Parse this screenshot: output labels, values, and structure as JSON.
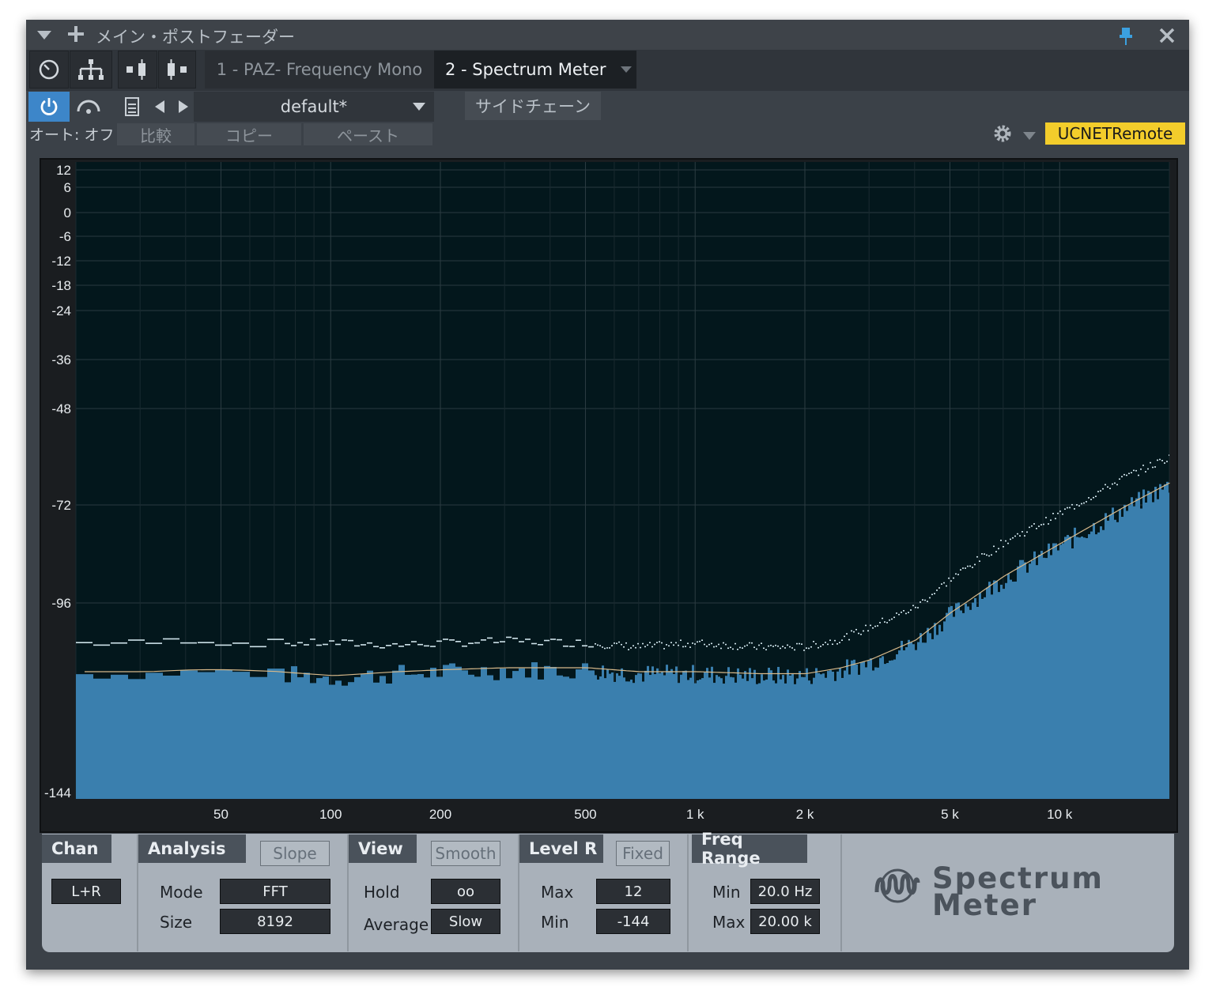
{
  "window": {
    "title": "メイン・ポストフェーダー",
    "tabs": [
      {
        "label": "1 - PAZ- Frequency Mono"
      },
      {
        "label": "2 - Spectrum Meter"
      }
    ]
  },
  "toolbar": {
    "preset": "default*",
    "sidechain": "サイドチェーン",
    "auto": "オート: オフ",
    "compare": "比較",
    "copy": "コピー",
    "paste": "ペースト",
    "remote": "UCNETRemote"
  },
  "colors": {
    "accent": "#3d86c9",
    "remote": "#f3cd2b",
    "spectrum_fill": "#3a7fae",
    "display_bg": "#03171c"
  },
  "spectrum": {
    "y_ticks": [
      "12",
      "6",
      "0",
      "-6",
      "-12",
      "-18",
      "-24",
      "-36",
      "-48",
      "-72",
      "-96",
      "-144"
    ],
    "x_ticks": [
      "50",
      "100",
      "200",
      "500",
      "1 k",
      "2 k",
      "5 k",
      "10 k"
    ]
  },
  "chart_data": {
    "type": "area",
    "x_scale": "log",
    "y_scale": "db",
    "xlim": [
      20,
      20000
    ],
    "ylim": [
      -144,
      12
    ],
    "x": [
      20,
      30,
      40,
      50,
      70,
      100,
      150,
      200,
      300,
      500,
      700,
      1000,
      1500,
      2000,
      2500,
      3000,
      4000,
      5000,
      7000,
      10000,
      15000,
      20000
    ],
    "series": [
      {
        "values": [
          -114,
          -114,
          -113.5,
          -113.5,
          -114,
          -115,
          -114,
          -113.5,
          -113,
          -113,
          -114,
          -114,
          -114.5,
          -114.5,
          -113,
          -111,
          -106,
          -99,
          -90,
          -82,
          -73,
          -67
        ]
      },
      {
        "values": [
          -106,
          -106,
          -105,
          -106,
          -106,
          -106,
          -106.5,
          -106,
          -105.5,
          -106,
          -107,
          -106,
          -107,
          -107,
          -105,
          -102,
          -97,
          -90,
          -81,
          -74,
          -65,
          -60
        ]
      }
    ]
  },
  "panel": {
    "chan": {
      "head": "Chan",
      "value": "L+R"
    },
    "analysis": {
      "head": "Analysis",
      "slope": "Slope",
      "mode_label": "Mode",
      "mode": "FFT",
      "size_label": "Size",
      "size": "8192"
    },
    "view": {
      "head": "View",
      "smooth": "Smooth",
      "hold_label": "Hold",
      "hold": "oo",
      "average_label": "Average",
      "average": "Slow"
    },
    "level": {
      "head": "Level R",
      "fixed": "Fixed",
      "max_label": "Max",
      "max": "12",
      "min_label": "Min",
      "min": "-144"
    },
    "freq": {
      "head": "Freq Range",
      "min_label": "Min",
      "min": "20.0 Hz",
      "max_label": "Max",
      "max": "20.00 k"
    },
    "brand": {
      "line1": "Spectrum",
      "line2": "Meter"
    }
  }
}
